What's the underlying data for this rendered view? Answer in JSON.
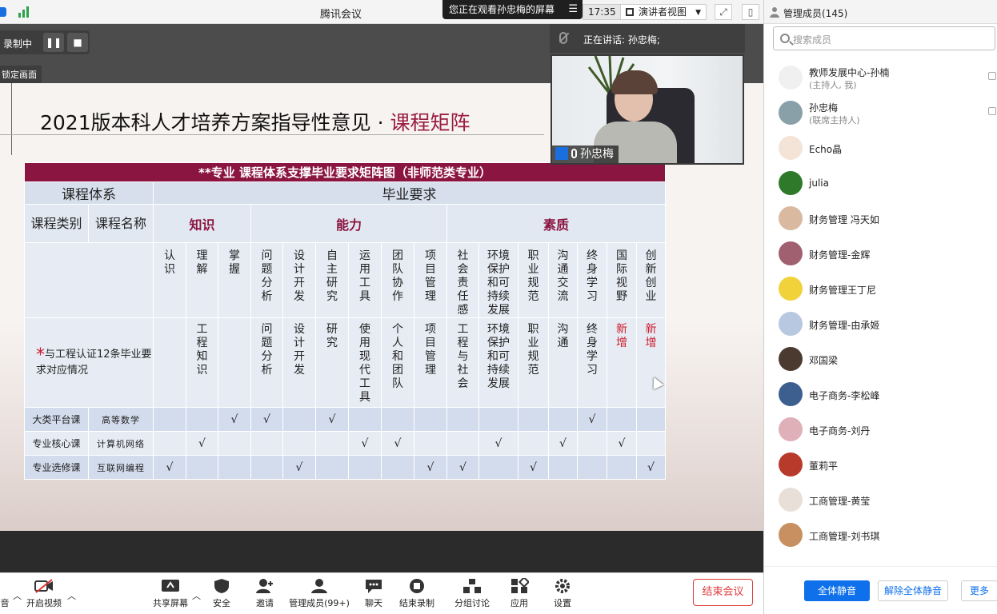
{
  "window": {
    "title": "腾讯会议",
    "clock": "17:35",
    "share_banner": "您正在观看孙忠梅的屏幕",
    "view_mode": "演讲者视图"
  },
  "recording": {
    "label": "录制中",
    "pause": "❚❚",
    "stop": "■",
    "lock_tip": "锁定画面"
  },
  "speaker": {
    "talking_label": "正在讲话: 孙忠梅;",
    "video_name": "孙忠梅"
  },
  "slide": {
    "title_main": "2021版本科人才培养方案指导性意见 ·",
    "title_accent": "课程矩阵",
    "table_title": "**专业  课程体系支撑毕业要求矩阵图（非师范类专业）",
    "hdr_system": "课程体系",
    "hdr_requirement": "毕业要求",
    "hdr_category": "课程类别",
    "hdr_name": "课程名称",
    "cat_knowledge": "知识",
    "cat_ability": "能力",
    "cat_quality": "素质",
    "subcols": [
      "认识",
      "理解",
      "掌握",
      "问题分析",
      "设计开发",
      "自主研究",
      "运用工具",
      "团队协作",
      "项目管理",
      "社会责任感",
      "环境保护和可持续发展",
      "职业规范",
      "沟通交流",
      "终身学习",
      "国际视野",
      "创新创业"
    ],
    "cert_label": "与工程认证12条毕业要求对应情况",
    "cert_star": "*",
    "cert_values": [
      "",
      "工程知识",
      "",
      "问题分析",
      "设计开发",
      "研究",
      "使用现代工具",
      "个人和团队",
      "项目管理",
      "工程与社会",
      "环境保护和可持续发展",
      "职业规范",
      "沟通",
      "终身学习",
      "新增",
      "新增"
    ],
    "rows": [
      {
        "type": "大类平台课",
        "name": "高等数学",
        "checks": [
          "",
          "",
          "√",
          "√",
          "",
          "√",
          "",
          "",
          "",
          "",
          "",
          "",
          "",
          "√",
          "",
          ""
        ]
      },
      {
        "type": "专业核心课",
        "name": "计算机网络",
        "checks": [
          "",
          "√",
          "",
          "",
          "",
          "",
          "√",
          "√",
          "",
          "",
          "√",
          "",
          "√",
          "",
          "√",
          ""
        ]
      },
      {
        "type": "专业选修课",
        "name": "互联网编程",
        "checks": [
          "√",
          "",
          "",
          "",
          "√",
          "",
          "",
          "",
          "√",
          "√",
          "",
          "√",
          "",
          "",
          "",
          "√"
        ]
      }
    ]
  },
  "toolbar": {
    "audio": "音",
    "video": "开启视频",
    "share": "共享屏幕",
    "security": "安全",
    "invite": "邀请",
    "members": "管理成员(99+)",
    "chat": "聊天",
    "end_record": "结束录制",
    "breakout": "分组讨论",
    "apps": "应用",
    "settings": "设置",
    "end_meeting": "结束会议"
  },
  "panel": {
    "title": "管理成员(145)",
    "search_placeholder": "搜索成员",
    "members": [
      {
        "name": "教师发展中心-孙楠",
        "sub": "(主持人, 我)",
        "color": "#f0f0f0"
      },
      {
        "name": "孙忠梅",
        "sub": "(联席主持人)",
        "color": "#8aa0a8"
      },
      {
        "name": "Echo晶",
        "sub": "",
        "color": "#f4e4d8"
      },
      {
        "name": "julia",
        "sub": "",
        "color": "#2f7a2a"
      },
      {
        "name": "财务管理 冯天如",
        "sub": "",
        "color": "#d9b9a0"
      },
      {
        "name": "财务管理-金辉",
        "sub": "",
        "color": "#a06070"
      },
      {
        "name": "财务管理王丁尼",
        "sub": "",
        "color": "#f2d23a"
      },
      {
        "name": "财务管理-由承姬",
        "sub": "",
        "color": "#b8c8e0"
      },
      {
        "name": "邓国梁",
        "sub": "",
        "color": "#4a3a30"
      },
      {
        "name": "电子商务-李松峰",
        "sub": "",
        "color": "#3c5f8f"
      },
      {
        "name": "电子商务-刘丹",
        "sub": "",
        "color": "#e0b0b8"
      },
      {
        "name": "董莉平",
        "sub": "",
        "color": "#b83a2a"
      },
      {
        "name": "工商管理-黄莹",
        "sub": "",
        "color": "#e8e0d8"
      },
      {
        "name": "工商管理-刘书琪",
        "sub": "",
        "color": "#c89060"
      }
    ],
    "mute_all": "全体静音",
    "unmute_all": "解除全体静音",
    "more": "更多"
  },
  "colors": {
    "accent": "#9a1d44",
    "table_header": "#8a1540",
    "primary": "#0e71eb",
    "end": "#e03b3b"
  }
}
